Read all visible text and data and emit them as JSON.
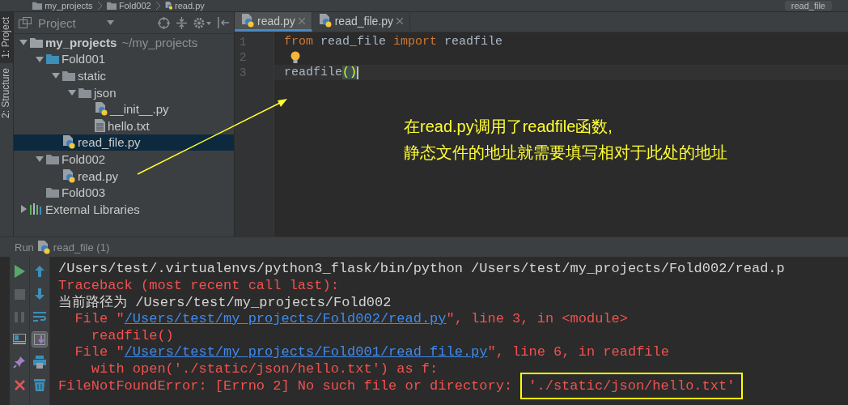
{
  "breadcrumb": {
    "items": [
      {
        "label": "my_projects",
        "kind": "folder"
      },
      {
        "label": "Fold002",
        "kind": "folder"
      },
      {
        "label": "read.py",
        "kind": "python"
      }
    ],
    "run_config": "read_file"
  },
  "tool_stripe": [
    {
      "label": "1: Project",
      "selected": true
    },
    {
      "label": "2: Structure",
      "selected": false
    }
  ],
  "project_panel": {
    "title": "Project",
    "tree": [
      {
        "name": "my_projects",
        "note": "~/my_projects",
        "kind": "module",
        "expanded": true,
        "selected": false,
        "children": [
          {
            "name": "Fold001",
            "kind": "source_folder",
            "expanded": true,
            "selected": false,
            "children": [
              {
                "name": "static",
                "kind": "folder",
                "expanded": true,
                "selected": false,
                "children": [
                  {
                    "name": "json",
                    "kind": "folder",
                    "expanded": true,
                    "selected": false,
                    "children": [
                      {
                        "name": "__init__.py",
                        "kind": "python",
                        "selected": false
                      },
                      {
                        "name": "hello.txt",
                        "kind": "text",
                        "selected": false
                      }
                    ]
                  }
                ]
              },
              {
                "name": "read_file.py",
                "kind": "python",
                "selected": true
              }
            ]
          },
          {
            "name": "Fold002",
            "kind": "folder",
            "expanded": true,
            "selected": false,
            "children": [
              {
                "name": "read.py",
                "kind": "python",
                "selected": false
              }
            ]
          },
          {
            "name": "Fold003",
            "kind": "folder",
            "selected": false
          }
        ]
      },
      {
        "name": "External Libraries",
        "kind": "library",
        "expanded": false,
        "selected": false
      }
    ]
  },
  "editor": {
    "tabs": [
      {
        "label": "read.py",
        "selected": true
      },
      {
        "label": "read_file.py",
        "selected": false
      }
    ],
    "lines": [
      {
        "number": "1",
        "current": false,
        "tokens": [
          {
            "text": "from",
            "kind": "keyword"
          },
          {
            "text": " read_file ",
            "kind": "plain"
          },
          {
            "text": "import",
            "kind": "keyword"
          },
          {
            "text": " readfile",
            "kind": "plain"
          }
        ]
      },
      {
        "number": "2",
        "current": false,
        "bulb": true
      },
      {
        "number": "3",
        "current": true,
        "tokens": [
          {
            "text": "readfile",
            "kind": "plain"
          },
          {
            "text": "()",
            "kind": "matched"
          }
        ]
      }
    ]
  },
  "annotation": {
    "lines": [
      "在read.py调用了readfile函数,",
      "静态文件的地址就需要填写相对于此处的地址"
    ]
  },
  "run_panel": {
    "label": "Run",
    "config": "read_file (1)",
    "left_tools": [
      {
        "kind": "run"
      },
      {
        "kind": "stop"
      },
      {
        "kind": "pause"
      },
      {
        "kind": "layout"
      },
      {
        "kind": "pin"
      },
      {
        "kind": "close"
      }
    ],
    "right_tools": [
      {
        "kind": "up",
        "selected": false
      },
      {
        "kind": "down",
        "selected": false
      },
      {
        "kind": "wrap",
        "selected": false
      },
      {
        "kind": "scroll",
        "selected": true
      },
      {
        "kind": "print",
        "selected": false
      },
      {
        "kind": "trash",
        "selected": false
      }
    ],
    "console": [
      [
        {
          "text": "/Users/test/.virtualenvs/python3_flask/bin/python /Users/test/my_projects/Fold002/read.p",
          "kind": "plain"
        }
      ],
      [
        {
          "text": "Traceback (most recent call last):",
          "kind": "error"
        }
      ],
      [
        {
          "text": "当前路径为 /Users/test/my_projects/Fold002",
          "kind": "plain"
        }
      ],
      [
        {
          "text": "  File \"",
          "kind": "error"
        },
        {
          "text": "/Users/test/my_projects/Fold002/read.py",
          "kind": "link"
        },
        {
          "text": "\", line 3, in <module>",
          "kind": "error"
        }
      ],
      [
        {
          "text": "    readfile()",
          "kind": "error"
        }
      ],
      [
        {
          "text": "  File \"",
          "kind": "error"
        },
        {
          "text": "/Users/test/my_projects/Fold001/read_file.py",
          "kind": "link"
        },
        {
          "text": "\", line 6, in readfile",
          "kind": "error"
        }
      ],
      [
        {
          "text": "    with open('./static/json/hello.txt') as f:",
          "kind": "error"
        }
      ],
      [
        {
          "text": "FileNotFoundError: [Errno 2] No such file or directory: ",
          "kind": "error"
        },
        {
          "text": "'./static/json/hello.txt'",
          "kind": "error",
          "highlighted": true
        }
      ]
    ]
  }
}
